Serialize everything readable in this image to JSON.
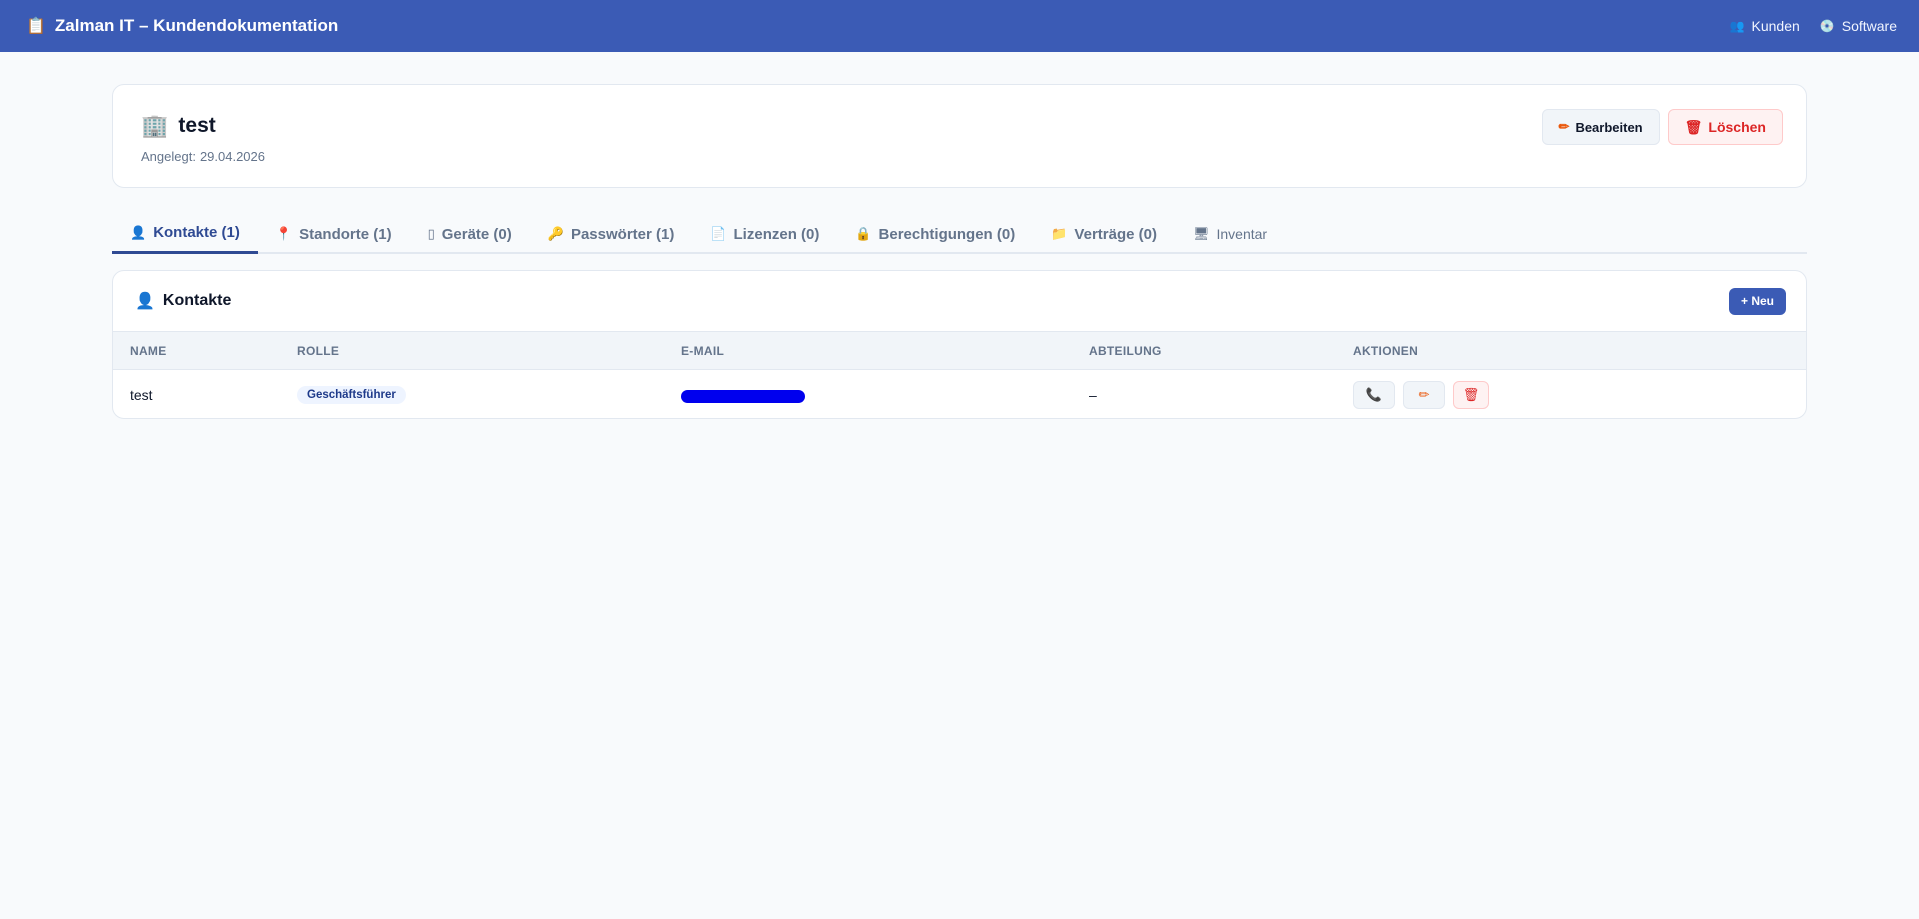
{
  "app": {
    "title": "Zalman IT – Kundendokumentation",
    "icon": "clipboard-icon",
    "nav": [
      {
        "label": "Kunden",
        "icon": "people-icon"
      },
      {
        "label": "Software",
        "icon": "disc-icon"
      }
    ]
  },
  "customer": {
    "name": "test",
    "icon": "building-icon",
    "created_label": "Angelegt:",
    "created_date": "29.04.2026",
    "edit_label": "Bearbeiten",
    "delete_label": "Löschen"
  },
  "tabs": [
    {
      "label": "Kontakte (1)",
      "icon": "person-icon",
      "glyph": "👤"
    },
    {
      "label": "Standorte (1)",
      "icon": "pin-icon",
      "glyph": "📍"
    },
    {
      "label": "Geräte (0)",
      "icon": "device-icon",
      "glyph": "🖥"
    },
    {
      "label": "Passwörter (1)",
      "icon": "key-icon",
      "glyph": "🔑"
    },
    {
      "label": "Lizenzen (0)",
      "icon": "document-icon",
      "glyph": "📄"
    },
    {
      "label": "Berechtigungen (0)",
      "icon": "lock-icon",
      "glyph": "🔒"
    },
    {
      "label": "Verträge (0)",
      "icon": "folder-icon",
      "glyph": "📁"
    },
    {
      "label": "Inventar",
      "icon": "monitor-icon",
      "glyph": "🖥"
    }
  ],
  "contacts": {
    "title": "Kontakte",
    "new_label": "+ Neu",
    "columns": [
      "NAME",
      "ROLLE",
      "E-MAIL",
      "ABTEILUNG",
      "AKTIONEN"
    ],
    "rows": [
      {
        "name": "test",
        "role": "Geschäftsführer",
        "department": "–"
      }
    ]
  },
  "colors": {
    "accent": "#3b5bb5",
    "danger": "#dc2626",
    "background": "#f8fafc"
  }
}
